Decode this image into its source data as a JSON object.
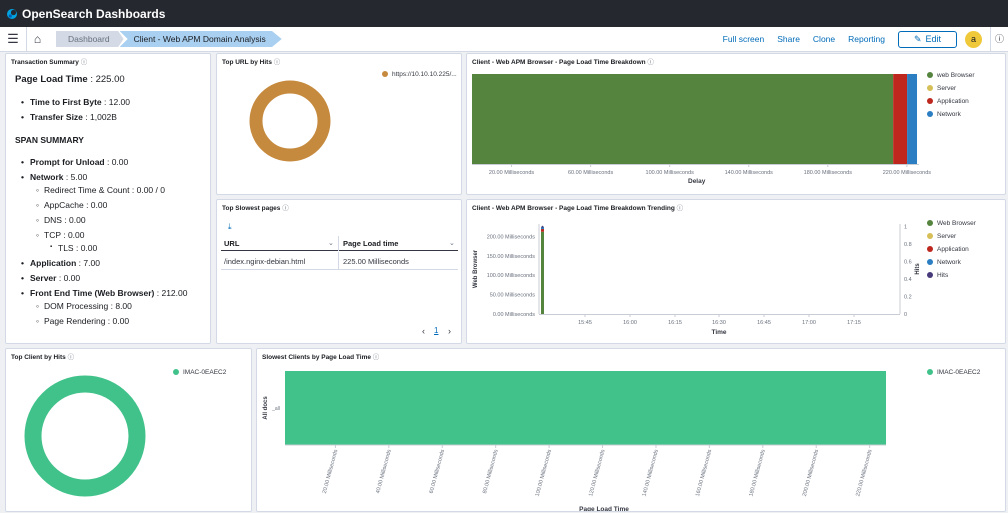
{
  "app": {
    "title": "OpenSearch Dashboards"
  },
  "nav": {
    "breadcrumbs": [
      "Dashboard",
      "Client - Web APM Domain Analysis"
    ],
    "links": [
      "Full screen",
      "Share",
      "Clone",
      "Reporting"
    ],
    "edit_label": "Edit",
    "avatar": "a"
  },
  "colors": {
    "browser": "#54843e",
    "server": "#d6bf57",
    "application": "#bd271e",
    "network": "#2b7ec1",
    "hits": "#493a7a",
    "url": "#c68a3e",
    "client": "#40c28a"
  },
  "transaction": {
    "title": "Transaction Summary",
    "page_load": {
      "label": "Page Load Time",
      "value": "225.00"
    },
    "ttfb": {
      "label": "Time to First Byte",
      "value": "12.00"
    },
    "transfer": {
      "label": "Transfer Size",
      "value": "1,002B"
    },
    "span_heading": "SPAN SUMMARY",
    "prompt": {
      "label": "Prompt for Unload",
      "value": "0.00"
    },
    "network": {
      "label": "Network",
      "value": "5.00"
    },
    "redirect": {
      "label": "Redirect Time & Count",
      "value": "0.00 / 0"
    },
    "appcache": {
      "label": "AppCache",
      "value": "0.00"
    },
    "dns": {
      "label": "DNS",
      "value": "0.00"
    },
    "tcp": {
      "label": "TCP",
      "value": "0.00"
    },
    "tls": {
      "label": "TLS",
      "value": "0.00"
    },
    "application": {
      "label": "Application",
      "value": "7.00"
    },
    "server": {
      "label": "Server",
      "value": "0.00"
    },
    "frontend": {
      "label": "Front End Time (Web Browser)",
      "value": "212.00"
    },
    "dom": {
      "label": "DOM Processing",
      "value": "8.00"
    },
    "render": {
      "label": "Page Rendering",
      "value": "0.00"
    }
  },
  "top_url": {
    "title": "Top URL by Hits",
    "legend": "https://10.10.10.225/..."
  },
  "breakdown": {
    "title": "Client - Web APM Browser - Page Load Time Breakdown",
    "legend": [
      "web Browser",
      "Server",
      "Application",
      "Network"
    ],
    "ticks": [
      "20.00 Milliseconds",
      "60.00 Milliseconds",
      "100.00 Milliseconds",
      "140.00 Milliseconds",
      "180.00 Milliseconds",
      "220.00 Milliseconds"
    ],
    "xlabel": "Delay"
  },
  "slowest": {
    "title": "Top Slowest pages",
    "col_url": "URL",
    "col_time": "Page Load time",
    "row_url": "/index.nginx-debian.html",
    "row_time": "225.00 Milliseconds",
    "page": "1"
  },
  "trending": {
    "title": "Client - Web APM Browser - Page Load Time Breakdown Trending",
    "legend": [
      "Web Browser",
      "Server",
      "Application",
      "Network",
      "Hits"
    ],
    "yticks": [
      "200.00 Milliseconds",
      "150.00 Milliseconds",
      "100.00 Milliseconds",
      "50.00 Milliseconds",
      "0.00 Milliseconds"
    ],
    "y2ticks": [
      "1",
      "0.8",
      "0.6",
      "0.4",
      "0.2",
      "0"
    ],
    "xticks": [
      "15:45",
      "16:00",
      "16:15",
      "16:30",
      "16:45",
      "17:00",
      "17:15"
    ],
    "ylabel": "Web Browser",
    "y2label": "Hits",
    "xlabel": "Time"
  },
  "top_client": {
    "title": "Top Client by Hits",
    "legend": "IMAC-0EAEC2"
  },
  "slow_clients": {
    "title": "Slowest Clients by Page Load Time",
    "legend": "IMAC-0EAEC2",
    "ylabel": "All docs",
    "ytick": "_all",
    "xticks": [
      "20.00 Milliseconds",
      "40.00 Milliseconds",
      "60.00 Milliseconds",
      "80.00 Milliseconds",
      "100.00 Milliseconds",
      "120.00 Milliseconds",
      "140.00 Milliseconds",
      "160.00 Milliseconds",
      "180.00 Milliseconds",
      "200.00 Milliseconds",
      "220.00 Milliseconds"
    ],
    "xlabel": "Page Load Time"
  },
  "chart_data": [
    {
      "type": "pie",
      "categories": [
        "https://10.10.10.225/..."
      ],
      "values": [
        1
      ]
    },
    {
      "type": "bar",
      "orientation": "horizontal",
      "stacked": true,
      "xlabel": "Delay",
      "series": [
        {
          "name": "web Browser",
          "values": [
            212
          ]
        },
        {
          "name": "Server",
          "values": [
            0
          ]
        },
        {
          "name": "Application",
          "values": [
            7
          ]
        },
        {
          "name": "Network",
          "values": [
            5
          ]
        }
      ],
      "xlim": [
        0,
        225
      ]
    },
    {
      "type": "bar",
      "xlabel": "Time",
      "ylabel": "Web Browser",
      "y2label": "Hits",
      "ylim": [
        0,
        225
      ],
      "y2lim": [
        0,
        1
      ],
      "x": [
        "15:35"
      ],
      "series": [
        {
          "name": "Web Browser",
          "values": [
            212
          ]
        },
        {
          "name": "Application",
          "values": [
            7
          ]
        },
        {
          "name": "Network",
          "values": [
            5
          ]
        },
        {
          "name": "Hits",
          "values": [
            1
          ]
        }
      ]
    },
    {
      "type": "pie",
      "categories": [
        "IMAC-0EAEC2"
      ],
      "values": [
        1
      ]
    },
    {
      "type": "bar",
      "orientation": "horizontal",
      "categories": [
        "_all"
      ],
      "series": [
        {
          "name": "IMAC-0EAEC2",
          "values": [
            225
          ]
        }
      ],
      "xlabel": "Page Load Time",
      "ylabel": "All docs",
      "xlim": [
        0,
        225
      ]
    }
  ]
}
